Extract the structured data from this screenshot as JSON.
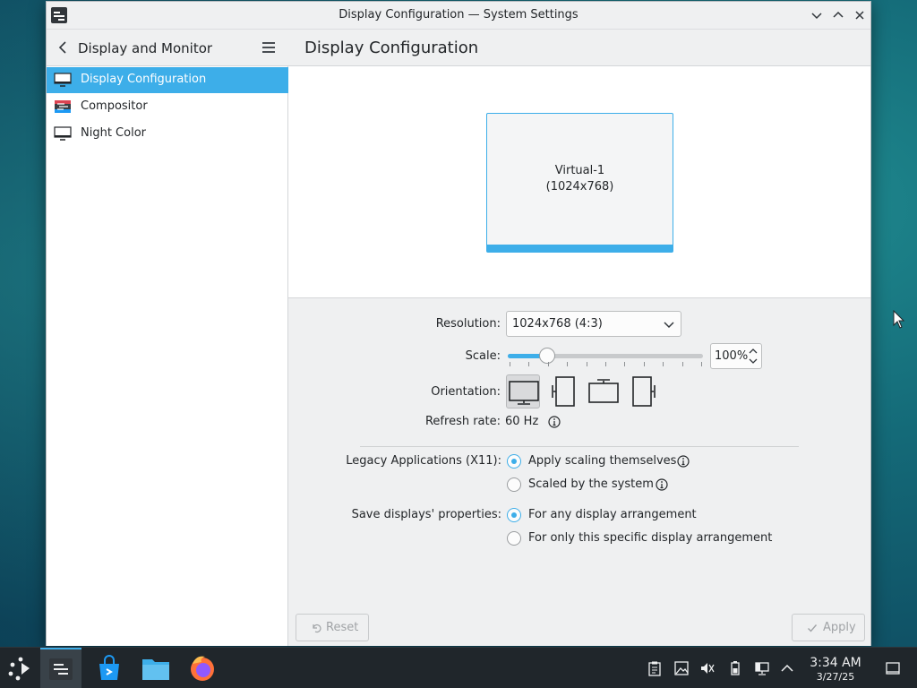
{
  "window": {
    "title": "Display Configuration — System Settings"
  },
  "sidebar": {
    "back_title": "Display and Monitor",
    "items": [
      {
        "label": "Display Configuration",
        "icon": "monitor-icon",
        "selected": true
      },
      {
        "label": "Compositor",
        "icon": "compositor-icon",
        "selected": false
      },
      {
        "label": "Night Color",
        "icon": "monitor-icon",
        "selected": false
      }
    ]
  },
  "main": {
    "title": "Display Configuration",
    "monitor": {
      "name": "Virtual-1",
      "resolution": "(1024x768)"
    },
    "resolution": {
      "label": "Resolution:",
      "value": "1024x768 (4:3)"
    },
    "scale": {
      "label": "Scale:",
      "value": "100%",
      "slider_fraction": 0.2
    },
    "orientation": {
      "label": "Orientation:",
      "selected": "landscape",
      "options": [
        "landscape",
        "portrait-left",
        "landscape-flipped",
        "portrait-right"
      ]
    },
    "refresh": {
      "label": "Refresh rate:",
      "value": "60 Hz"
    },
    "legacy": {
      "label": "Legacy Applications (X11):",
      "options": [
        "Apply scaling themselves",
        "Scaled by the system"
      ],
      "selected": 0
    },
    "save": {
      "label": "Save displays' properties:",
      "options": [
        "For any display arrangement",
        "For only this specific display arrangement"
      ],
      "selected": 0
    },
    "buttons": {
      "reset": "Reset",
      "apply": "Apply"
    }
  },
  "taskbar": {
    "apps": [
      "system-settings",
      "discover",
      "dolphin-file-manager",
      "firefox"
    ],
    "active_app": "system-settings",
    "tray": [
      "clipboard-icon",
      "screenshot-icon",
      "volume-muted-icon",
      "battery-icon",
      "network-icon",
      "expand-tray-icon"
    ],
    "time": "3:34 AM",
    "date": "3/27/25"
  },
  "colors": {
    "accent": "#3daee9",
    "window_bg": "#eff0f1",
    "panel_bg": "#20262b"
  }
}
